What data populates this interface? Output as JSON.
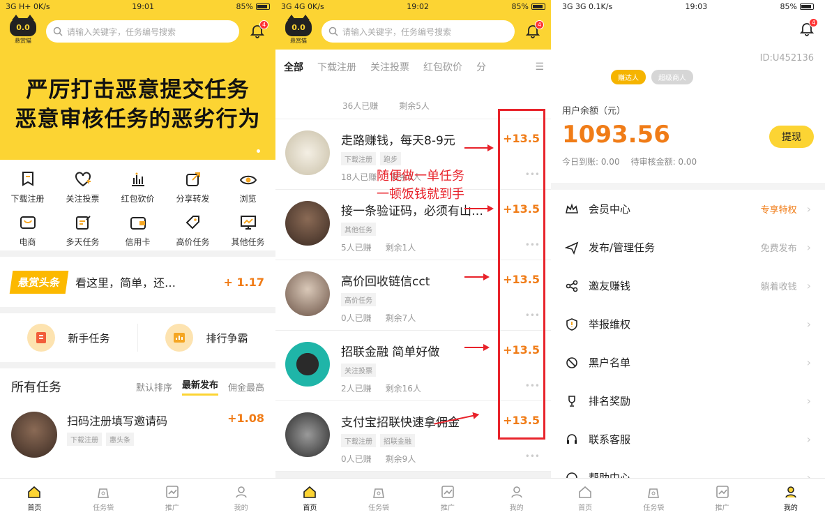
{
  "panel1": {
    "status": {
      "left": "3G  H+  0K/s",
      "time": "19:01",
      "battery": "85%"
    },
    "logo_text": "0.0",
    "logo_sub": "悬赏猫",
    "search_placeholder": "请输入关键字，任务编号搜索",
    "bell_badge": "4",
    "banner_line1": "严厉打击恶意提交任务",
    "banner_line2": "恶意审核任务的恶劣行为",
    "grid": [
      {
        "label": "下载注册",
        "icon": "download-icon"
      },
      {
        "label": "关注投票",
        "icon": "heart-plus-icon"
      },
      {
        "label": "红包砍价",
        "icon": "bar-chart-icon"
      },
      {
        "label": "分享转发",
        "icon": "share-icon"
      },
      {
        "label": "浏览",
        "icon": "eye-icon"
      },
      {
        "label": "电商",
        "icon": "shop-icon"
      },
      {
        "label": "多天任务",
        "icon": "edit-icon"
      },
      {
        "label": "信用卡",
        "icon": "wallet-icon"
      },
      {
        "label": "高价任务",
        "icon": "tag-icon"
      },
      {
        "label": "其他任务",
        "icon": "monitor-icon"
      }
    ],
    "news_tag": "悬赏头条",
    "news_text": "看这里，简单，还…",
    "news_value": "+ 1.17",
    "quick": [
      {
        "label": "新手任务"
      },
      {
        "label": "排行争霸"
      }
    ],
    "tasks_title": "所有任务",
    "sort": [
      "默认排序",
      "最新发布",
      "佣金最高"
    ],
    "task": {
      "title": "扫码注册填写邀请码",
      "amount": "+1.08",
      "tags": [
        "下载注册",
        "惠头条"
      ]
    },
    "tabbar": [
      "首页",
      "任务袋",
      "推广",
      "我的"
    ]
  },
  "panel2": {
    "status": {
      "left": "3G  4G  0K/s",
      "time": "19:02",
      "battery": "85%"
    },
    "search_placeholder": "请输入关键字，任务编号搜索",
    "bell_badge": "4",
    "tabs": [
      "全部",
      "下载注册",
      "关注投票",
      "红包砍价",
      "分"
    ],
    "top_meta": {
      "earned": "36人已赚",
      "left": "剩余5人"
    },
    "items": [
      {
        "title": "走路赚钱，每天8-9元",
        "amount": "+13.5",
        "tags": [
          "下载注册",
          "跑步"
        ],
        "earned": "18人已赚",
        "left": "剩余4人"
      },
      {
        "title": "接一条验证码，必须有山…",
        "amount": "+13.5",
        "tags": [
          "其他任务"
        ],
        "earned": "5人已赚",
        "left": "剩余1人"
      },
      {
        "title": "高价回收链信cct",
        "amount": "+13.5",
        "tags": [
          "高价任务"
        ],
        "earned": "0人已赚",
        "left": "剩余7人"
      },
      {
        "title": "招联金融  简单好做",
        "amount": "+13.5",
        "tags": [
          "关注投票"
        ],
        "earned": "2人已赚",
        "left": "剩余16人"
      },
      {
        "title": "支付宝招联快速拿佣金",
        "amount": "+13.5",
        "tags": [
          "下载注册",
          "招联金融"
        ],
        "earned": "0人已赚",
        "left": "剩余9人"
      }
    ],
    "annotation_line1": "随便做一单任务",
    "annotation_line2": "一顿饭钱就到手",
    "tabbar": [
      "首页",
      "任务袋",
      "推广",
      "我的"
    ]
  },
  "panel3": {
    "status": {
      "left": "3G  3G  0.1K/s",
      "time": "19:03",
      "battery": "85%"
    },
    "bell_badge": "4",
    "uid": "ID:U452136",
    "pill1": "赚达人",
    "pill2": "超级商人",
    "balance_label": "用户余额（元）",
    "balance": "1093.56",
    "today": "今日到账: 0.00",
    "pending": "待审核金额: 0.00",
    "withdraw": "提现",
    "menu": [
      {
        "label": "会员中心",
        "right": "专享特权",
        "icon": "crown-icon"
      },
      {
        "label": "发布/管理任务",
        "right": "免费发布",
        "icon": "send-icon"
      },
      {
        "label": "邀友赚钱",
        "right": "躺着收钱",
        "icon": "share-nodes-icon"
      },
      {
        "label": "举报维权",
        "right": "",
        "icon": "shield-alert-icon"
      },
      {
        "label": "黑户名单",
        "right": "",
        "icon": "ban-icon"
      },
      {
        "label": "排名奖励",
        "right": "",
        "icon": "trophy-icon"
      },
      {
        "label": "联系客服",
        "right": "",
        "icon": "headset-icon"
      },
      {
        "label": "帮助中心",
        "right": "",
        "icon": "help-icon"
      }
    ],
    "tabbar": [
      "首页",
      "任务袋",
      "推广",
      "我的"
    ]
  },
  "colors": {
    "brand_yellow": "#fcd433",
    "amount_orange": "#f07c17",
    "annotation_red": "#e8232b"
  }
}
